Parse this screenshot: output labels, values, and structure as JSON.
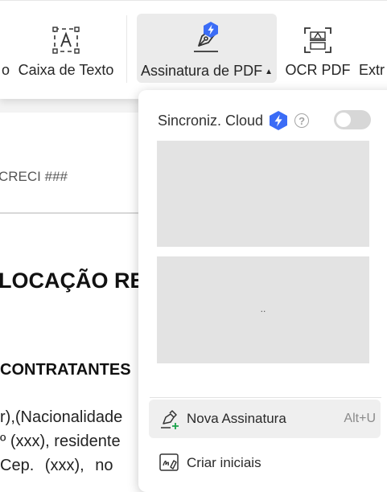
{
  "toolbar": {
    "prev_label": "o",
    "caixa_label": "Caixa de Texto",
    "assinatura_label": "Assinatura de PDF",
    "ocr_label": "OCR PDF",
    "extr_label": "Extr"
  },
  "document": {
    "creci": "CRECI ###",
    "heading": "LOCAÇÃO RES",
    "contratantes": "CONTRATANTES",
    "line1": "r),(Nacionalidade",
    "line2": "º (xxx), residente",
    "line3": "Cep. (xxx), no"
  },
  "dropdown": {
    "sync_label": "Sincroniz. Cloud",
    "help_glyph": "?",
    "sync_enabled": false,
    "slot2_text": "..",
    "items": [
      {
        "label": "Nova Assinatura",
        "shortcut": "Alt+U",
        "icon": "pen-plus-icon"
      },
      {
        "label": "Criar iniciais",
        "shortcut": "",
        "icon": "initials-icon"
      }
    ]
  },
  "colors": {
    "ai_badge": "#3b6cf6",
    "hover_bg": "#efefef",
    "toggle_off": "#d7d7d7"
  }
}
